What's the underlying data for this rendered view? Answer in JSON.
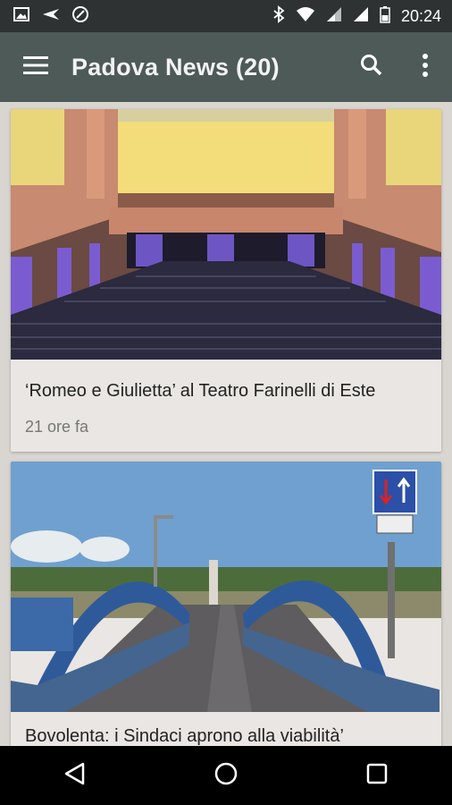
{
  "status_bar": {
    "time": "20:24",
    "left_icons": [
      "image-icon",
      "plane-icon",
      "shield-icon"
    ],
    "right_icons": [
      "bluetooth-icon",
      "wifi-icon",
      "signal-icon",
      "signal-icon",
      "battery-icon"
    ]
  },
  "toolbar": {
    "title": "Padova News (20)",
    "actions": [
      "menu-icon",
      "search-icon",
      "more-vert-icon"
    ]
  },
  "articles": [
    {
      "title": "‘Romeo e Giulietta’ al Teatro Farinelli di Este",
      "time": "21 ore fa",
      "image": "theater-hall"
    },
    {
      "title": "Bovolenta: i Sindaci aprono alla viabilità’",
      "time": "",
      "image": "blue-bridge-road"
    }
  ],
  "nav_bar": {
    "buttons": [
      "back-icon",
      "home-icon",
      "recents-icon"
    ]
  },
  "colors": {
    "status_bar": "#2e3233",
    "toolbar": "#4d5a58",
    "background": "#d9d5d1",
    "card": "#e9e6e3"
  }
}
